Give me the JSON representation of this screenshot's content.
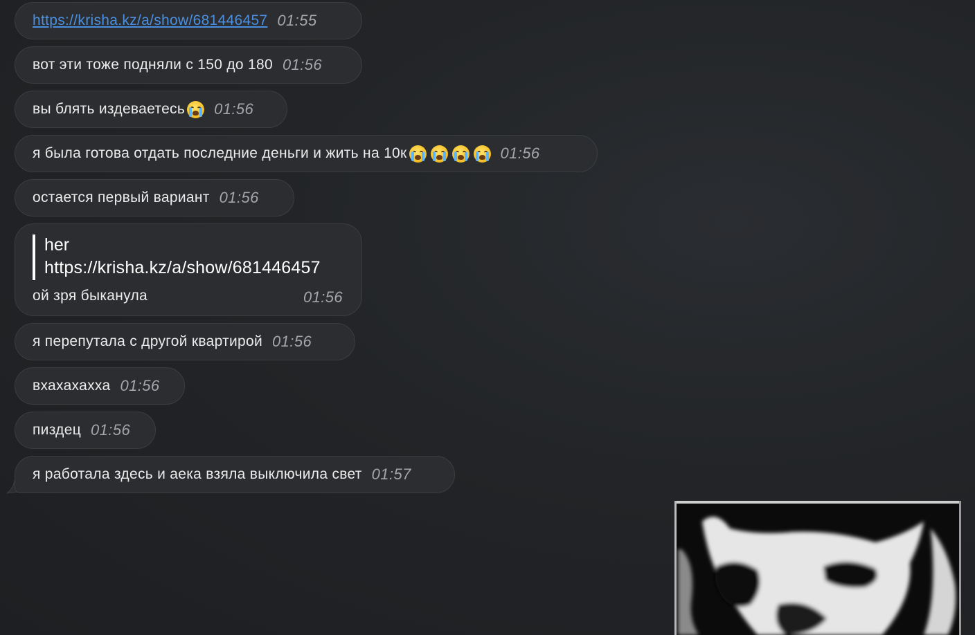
{
  "messages": [
    {
      "text": "https://krisha.kz/a/show/681446457",
      "time": "01:55",
      "is_link": true
    },
    {
      "text": "вот эти тоже подняли с 150 до 180",
      "time": "01:56"
    },
    {
      "text": "вы блять издеваетесь",
      "emoji": "loudly-crying-face",
      "emoji_count": 1,
      "time": "01:56"
    },
    {
      "text": "я была готова отдать последние деньги и жить на 10к",
      "emoji": "loudly-crying-face",
      "emoji_count": 4,
      "time": "01:56"
    },
    {
      "text": "остается первый вариант",
      "time": "01:56"
    },
    {
      "reply_to": {
        "author": "her",
        "text": "https://krisha.kz/a/show/681446457"
      },
      "text": "ой зря быканула",
      "time": "01:56"
    },
    {
      "text": "я перепутала с другой квартирой",
      "time": "01:56"
    },
    {
      "text": "вхахахахха",
      "time": "01:56"
    },
    {
      "text": "пиздец",
      "time": "01:56"
    },
    {
      "text": "я работала здесь и аека взяла выключила свет",
      "time": "01:57"
    }
  ],
  "photo": {
    "description_icon": "cow-image"
  },
  "colors": {
    "background": "#222427",
    "bubble": "#2b2d30",
    "link": "#4a90e2",
    "time": "#a4a6ab"
  }
}
